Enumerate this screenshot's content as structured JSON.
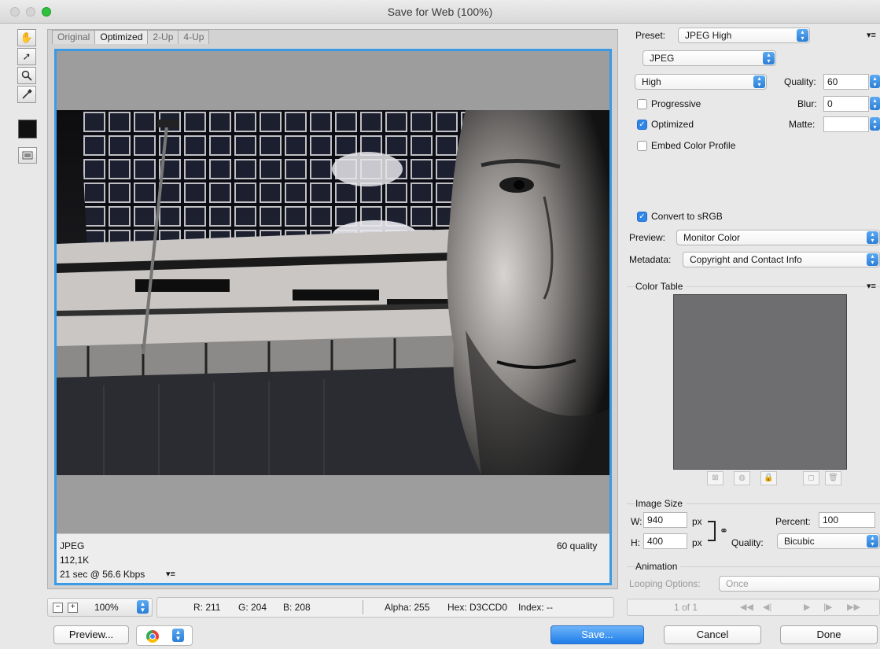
{
  "window": {
    "title": "Save for Web (100%)"
  },
  "tools": [
    {
      "name": "hand-tool-icon",
      "glyph": "✋"
    },
    {
      "name": "slice-select-tool-icon",
      "glyph": "➚"
    },
    {
      "name": "zoom-tool-icon",
      "glyph": "🔍"
    },
    {
      "name": "eyedropper-tool-icon",
      "glyph": "✎"
    }
  ],
  "tabs": [
    "Original",
    "Optimized",
    "2-Up",
    "4-Up"
  ],
  "active_tab": "Optimized",
  "preview_info": {
    "format": "JPEG",
    "size": "112,1K",
    "time": "21 sec @ 56.6 Kbps",
    "quality": "60 quality"
  },
  "status": {
    "zoom": "100%",
    "r": "R: 211",
    "g": "G: 204",
    "b": "B: 208",
    "alpha": "Alpha: 255",
    "hex": "Hex: D3CCD0",
    "index": "Index: --"
  },
  "buttons": {
    "preview": "Preview...",
    "save": "Save...",
    "cancel": "Cancel",
    "done": "Done"
  },
  "panel": {
    "preset_label": "Preset:",
    "preset_value": "JPEG High",
    "format_value": "JPEG",
    "compression_value": "High",
    "quality_label": "Quality:",
    "quality_value": "60",
    "blur_label": "Blur:",
    "blur_value": "0",
    "matte_label": "Matte:",
    "matte_value": "",
    "progressive_label": "Progressive",
    "progressive_checked": false,
    "optimized_label": "Optimized",
    "optimized_checked": true,
    "embed_label": "Embed Color Profile",
    "embed_checked": false,
    "srgb_label": "Convert to sRGB",
    "srgb_checked": true,
    "preview_label": "Preview:",
    "preview_value": "Monitor Color",
    "metadata_label": "Metadata:",
    "metadata_value": "Copyright and Contact Info",
    "color_table_label": "Color Table",
    "image_size_label": "Image Size",
    "w_label": "W:",
    "w_value": "940",
    "h_label": "H:",
    "h_value": "400",
    "px": "px",
    "percent_label": "Percent:",
    "percent_value": "100",
    "resample_label": "Quality:",
    "resample_value": "Bicubic",
    "animation_label": "Animation",
    "looping_label": "Looping Options:",
    "looping_value": "Once",
    "frame_counter": "1 of 1"
  },
  "colors": {
    "accent": "#3b9ae4",
    "canvas_bg": "#9d9d9d",
    "color_table_bg": "#6e6e70"
  }
}
